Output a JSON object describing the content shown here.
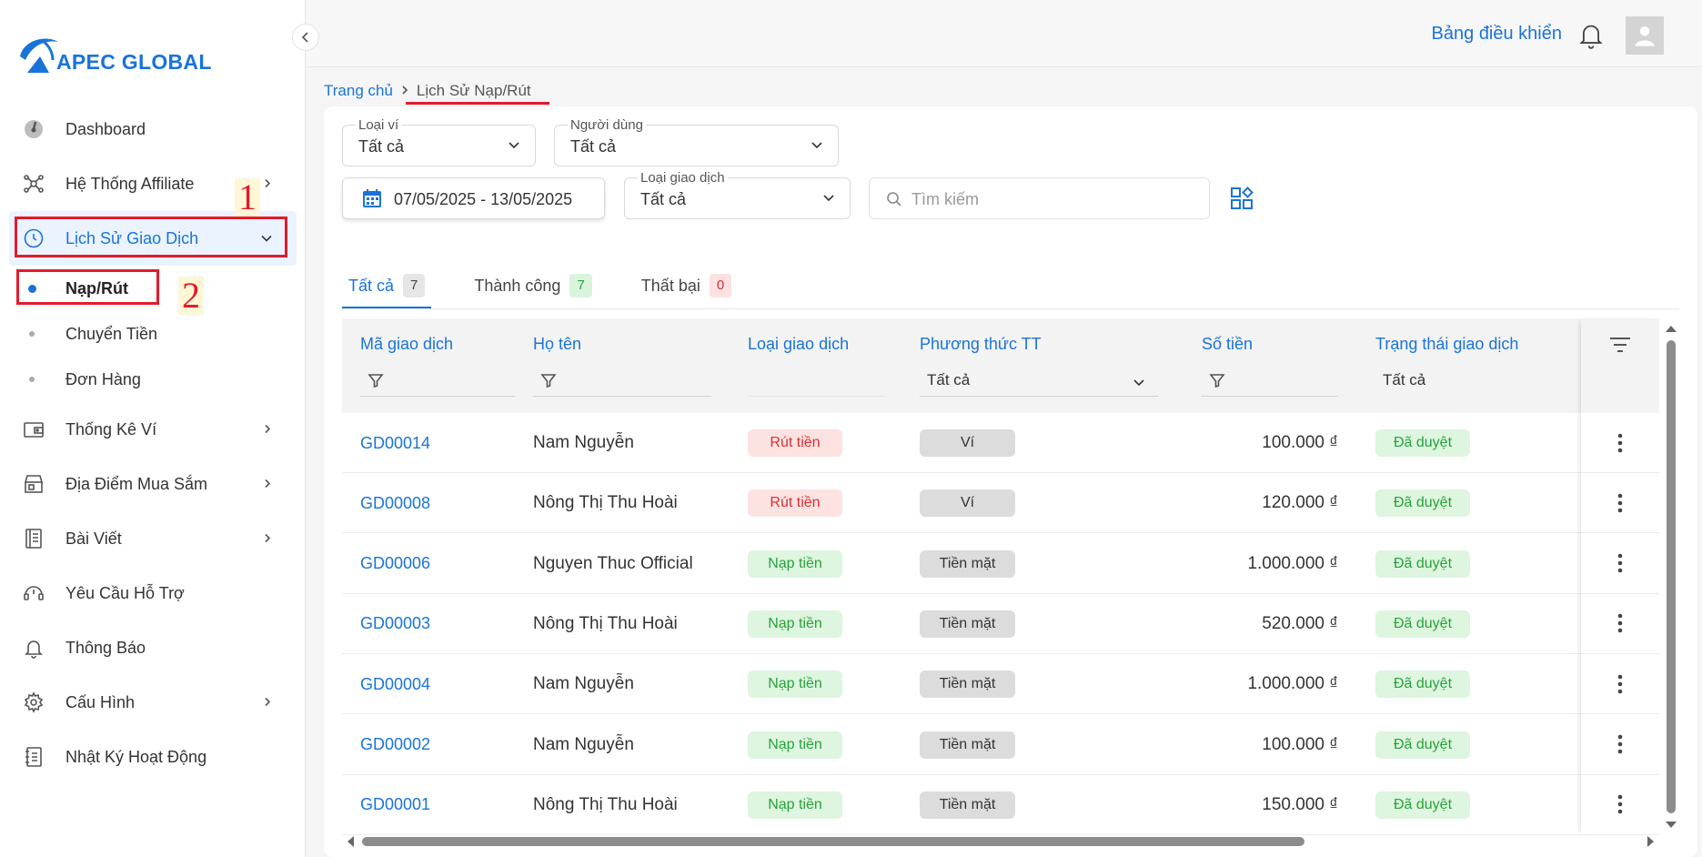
{
  "app": {
    "logo_text": "APEC GLOBAL",
    "brand_color": "#1a73d9"
  },
  "sidebar": {
    "items": [
      {
        "label": "Dashboard",
        "icon": "gauge-icon"
      },
      {
        "label": "Hệ Thống Affiliate",
        "icon": "network-icon"
      },
      {
        "label": "Lịch Sử Giao Dịch",
        "icon": "clock-icon"
      },
      {
        "label": "Thống Kê Ví",
        "icon": "wallet-icon"
      },
      {
        "label": "Địa Điểm Mua Sắm",
        "icon": "store-icon"
      },
      {
        "label": "Bài Viết",
        "icon": "article-icon"
      },
      {
        "label": "Yêu Cầu Hỗ Trợ",
        "icon": "headset-icon"
      },
      {
        "label": "Thông Báo",
        "icon": "bell-icon"
      },
      {
        "label": "Cấu Hình",
        "icon": "gear-icon"
      },
      {
        "label": "Nhật Ký Hoạt Động",
        "icon": "log-icon"
      }
    ],
    "sub_items": [
      {
        "label": "Nạp/Rút"
      },
      {
        "label": "Chuyển Tiền"
      },
      {
        "label": "Đơn Hàng"
      }
    ],
    "annotations": [
      "1",
      "2"
    ]
  },
  "header": {
    "dashboard_link": "Bảng điều khiển"
  },
  "breadcrumb": {
    "home": "Trang chủ",
    "current": "Lịch Sử Nạp/Rút"
  },
  "filters": {
    "wallet_type": {
      "label": "Loại ví",
      "value": "Tất cả"
    },
    "user": {
      "label": "Người dùng",
      "value": "Tất cả"
    },
    "date_range": {
      "value": "07/05/2025 - 13/05/2025"
    },
    "transaction_type": {
      "label": "Loại giao dịch",
      "value": "Tất cả"
    },
    "search": {
      "placeholder": "Tìm kiếm"
    }
  },
  "tabs": [
    {
      "label": "Tất cả",
      "count": "7"
    },
    {
      "label": "Thành công",
      "count": "7"
    },
    {
      "label": "Thất bại",
      "count": "0"
    }
  ],
  "table": {
    "columns": [
      "Mã giao dịch",
      "Họ tên",
      "Loại giao dịch",
      "Phương thức TT",
      "Số tiền",
      "Trạng thái giao dịch"
    ],
    "column_filters": {
      "payment_method": "Tất cả",
      "status": "Tất cả"
    },
    "rows": [
      {
        "code": "GD00014",
        "name": "Nam Nguyễn",
        "type": "Rút tiền",
        "method": "Ví",
        "amount": "100.000 ₫",
        "status": "Đã duyệt"
      },
      {
        "code": "GD00008",
        "name": "Nông Thị Thu Hoài",
        "type": "Rút tiền",
        "method": "Ví",
        "amount": "120.000 ₫",
        "status": "Đã duyệt"
      },
      {
        "code": "GD00006",
        "name": "Nguyen Thuc Official",
        "type": "Nạp tiền",
        "method": "Tiền mặt",
        "amount": "1.000.000 ₫",
        "status": "Đã duyệt"
      },
      {
        "code": "GD00003",
        "name": "Nông Thị Thu Hoài",
        "type": "Nạp tiền",
        "method": "Tiền mặt",
        "amount": "520.000 ₫",
        "status": "Đã duyệt"
      },
      {
        "code": "GD00004",
        "name": "Nam Nguyễn",
        "type": "Nạp tiền",
        "method": "Tiền mặt",
        "amount": "1.000.000 ₫",
        "status": "Đã duyệt"
      },
      {
        "code": "GD00002",
        "name": "Nam Nguyễn",
        "type": "Nạp tiền",
        "method": "Tiền mặt",
        "amount": "100.000 ₫",
        "status": "Đã duyệt"
      },
      {
        "code": "GD00001",
        "name": "Nông Thị Thu Hoài",
        "type": "Nạp tiền",
        "method": "Tiền mặt",
        "amount": "150.000 ₫",
        "status": "Đã duyệt"
      }
    ]
  }
}
